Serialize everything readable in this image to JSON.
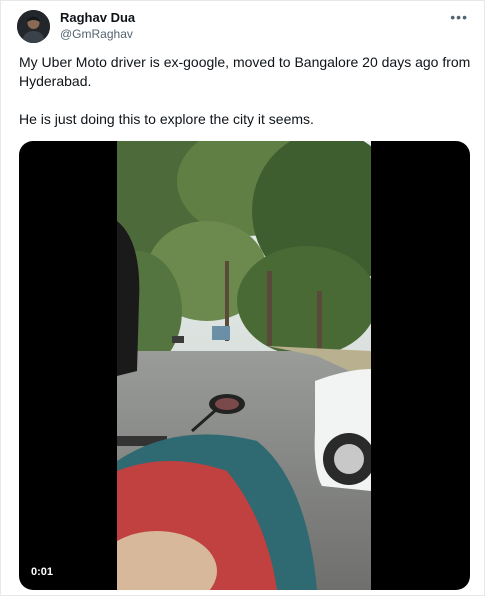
{
  "tweet": {
    "display_name": "Raghav Dua",
    "handle": "@GmRaghav",
    "more_icon": "more-options-icon",
    "text_lines": [
      "My Uber Moto driver is ex-google, moved to Bangalore 20 days ago from Hyderabad.",
      "He is just doing this to explore the city it seems."
    ]
  },
  "video": {
    "timestamp": "0:01",
    "description_icon": "video-player"
  }
}
